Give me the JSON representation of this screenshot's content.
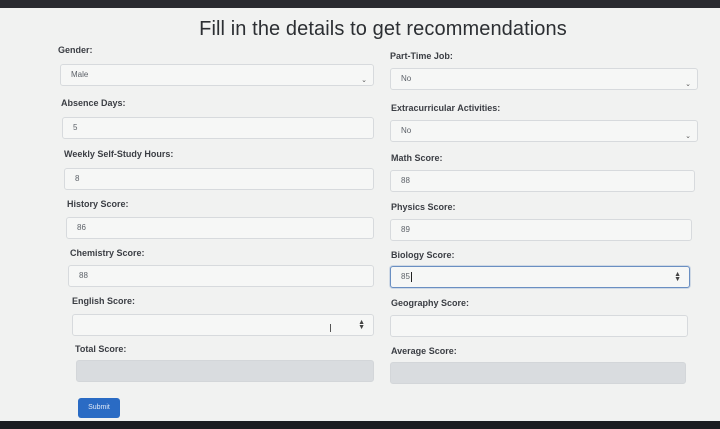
{
  "page": {
    "title": "Fill in the details to get recommendations"
  },
  "left": [
    {
      "key": "gender",
      "label": "Gender:",
      "value": "Male",
      "type": "select"
    },
    {
      "key": "absence_days",
      "label": "Absence Days:",
      "value": "5",
      "type": "number"
    },
    {
      "key": "weekly_self_study",
      "label": "Weekly Self-Study Hours:",
      "value": "8",
      "type": "number"
    },
    {
      "key": "history_score",
      "label": "History Score:",
      "value": "86",
      "type": "number"
    },
    {
      "key": "chemistry_score",
      "label": "Chemistry Score:",
      "value": "88",
      "type": "number"
    },
    {
      "key": "english_score",
      "label": "English Score:",
      "value": "",
      "type": "number"
    },
    {
      "key": "total_score",
      "label": "Total Score:",
      "value": "",
      "type": "readonly"
    }
  ],
  "right": [
    {
      "key": "part_time_job",
      "label": "Part-Time Job:",
      "value": "No",
      "type": "select"
    },
    {
      "key": "extracurricular",
      "label": "Extracurricular Activities:",
      "value": "No",
      "type": "select"
    },
    {
      "key": "math_score",
      "label": "Math Score:",
      "value": "88",
      "type": "number"
    },
    {
      "key": "physics_score",
      "label": "Physics Score:",
      "value": "89",
      "type": "number"
    },
    {
      "key": "biology_score",
      "label": "Biology Score:",
      "value": "85",
      "type": "number"
    },
    {
      "key": "geography_score",
      "label": "Geography Score:",
      "value": "",
      "type": "number"
    },
    {
      "key": "average_score",
      "label": "Average Score:",
      "value": "",
      "type": "readonly"
    }
  ],
  "submit": {
    "label": "Submit"
  },
  "colors": {
    "primary": "#2a6bc4",
    "focus_border": "#6a8fc2",
    "readonly_bg": "#d9dcdf"
  }
}
